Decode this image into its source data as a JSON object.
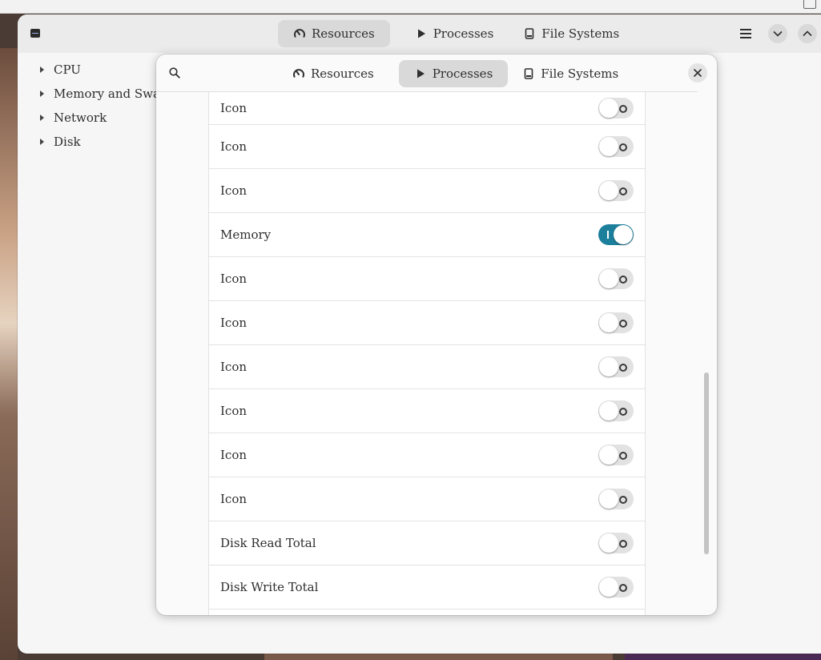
{
  "main": {
    "tabs": [
      {
        "label": "Resources",
        "icon": "gauge-icon"
      },
      {
        "label": "Processes",
        "icon": "play-icon"
      },
      {
        "label": "File Systems",
        "icon": "drive-icon"
      }
    ],
    "active_tab": "Resources",
    "sidebar": [
      {
        "label": "CPU"
      },
      {
        "label": "Memory and Swap"
      },
      {
        "label": "Network"
      },
      {
        "label": "Disk"
      }
    ]
  },
  "dialog": {
    "tabs": [
      {
        "label": "Resources",
        "icon": "gauge-icon"
      },
      {
        "label": "Processes",
        "icon": "play-icon"
      },
      {
        "label": "File Systems",
        "icon": "drive-icon"
      }
    ],
    "active_tab": "Processes",
    "rows": [
      {
        "label": "Icon",
        "enabled": false
      },
      {
        "label": "Icon",
        "enabled": false
      },
      {
        "label": "Icon",
        "enabled": false
      },
      {
        "label": "Memory",
        "enabled": true
      },
      {
        "label": "Icon",
        "enabled": false
      },
      {
        "label": "Icon",
        "enabled": false
      },
      {
        "label": "Icon",
        "enabled": false
      },
      {
        "label": "Icon",
        "enabled": false
      },
      {
        "label": "Icon",
        "enabled": false
      },
      {
        "label": "Icon",
        "enabled": false
      },
      {
        "label": "Disk Read Total",
        "enabled": false
      },
      {
        "label": "Disk Write Total",
        "enabled": false
      }
    ]
  },
  "colors": {
    "accent": "#1c7f9c",
    "tab_active_bg": "#d9d9d9",
    "window_bg": "#f6f6f6"
  }
}
